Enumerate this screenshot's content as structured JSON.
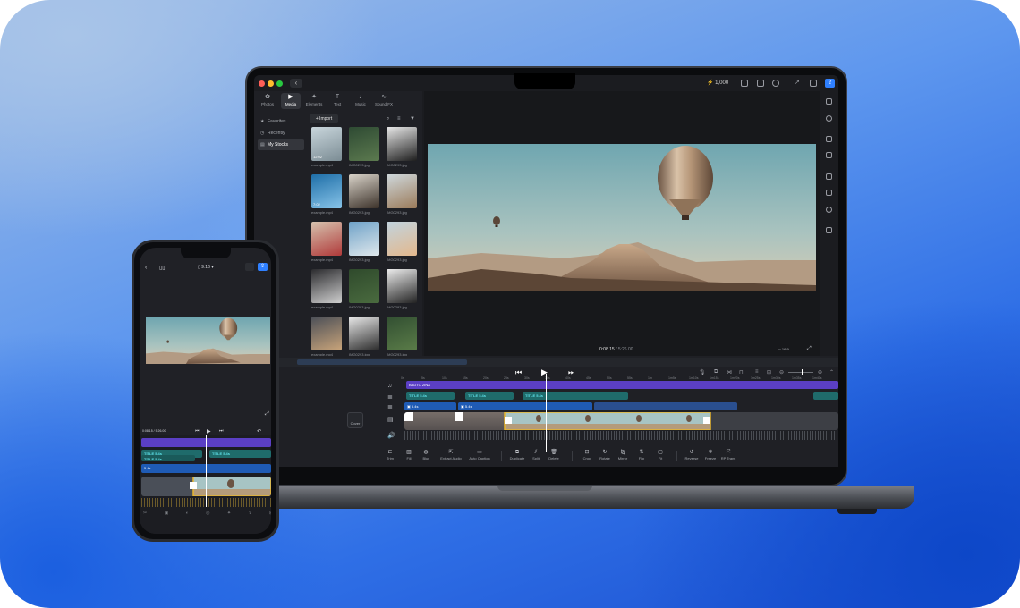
{
  "laptop": {
    "credits": "1,000",
    "categories": [
      {
        "label": "Photos",
        "icon": "photos-icon",
        "glyph": "✿"
      },
      {
        "label": "Media",
        "icon": "media-icon",
        "glyph": "▶"
      },
      {
        "label": "Elements",
        "icon": "elements-icon",
        "glyph": "✦"
      },
      {
        "label": "Text",
        "icon": "text-icon",
        "glyph": "T"
      },
      {
        "label": "Music",
        "icon": "music-icon",
        "glyph": "♪"
      },
      {
        "label": "Sound FX",
        "icon": "soundfx-icon",
        "glyph": "∿"
      }
    ],
    "side_nav": [
      {
        "label": "Favorites",
        "glyph": "★"
      },
      {
        "label": "Recently",
        "glyph": "◷"
      },
      {
        "label": "My Stocks",
        "glyph": "▤"
      }
    ],
    "import_label": "+ Import",
    "media": [
      {
        "name": "example.mp4",
        "duration": "12:02"
      },
      {
        "name": "IMG0293.jpg",
        "duration": ""
      },
      {
        "name": "IMG0293.jpg",
        "duration": ""
      },
      {
        "name": "example.mp4",
        "duration": "7:02"
      },
      {
        "name": "IMG0293.jpg",
        "duration": ""
      },
      {
        "name": "IMG0293.jpg",
        "duration": ""
      },
      {
        "name": "example.mp4",
        "duration": ""
      },
      {
        "name": "IMG0293.jpg",
        "duration": ""
      },
      {
        "name": "IMG0293.jpg",
        "duration": ""
      },
      {
        "name": "example.mp4",
        "duration": ""
      },
      {
        "name": "IMG0293.jpg",
        "duration": ""
      },
      {
        "name": "IMG0293.jpg",
        "duration": ""
      },
      {
        "name": "example.mp4",
        "duration": ""
      },
      {
        "name": "IMG0293.jpg",
        "duration": ""
      },
      {
        "name": "IMG0293.jpg",
        "duration": ""
      }
    ],
    "timecode_current": "0:08.15",
    "timecode_total": " / 5:26.00",
    "aspect_ratio": "16:9",
    "cover_label": "Cover",
    "tracks": {
      "music": "BADTO ZINA",
      "text1": "TITLE 5.4s",
      "text2": "TITLE 5.4s",
      "text3": "TITLE 5.4s",
      "text4": "TITLE 5.4s",
      "audio1": "5.4s",
      "audio2": "5.4s"
    },
    "ruler": [
      "0s",
      "5s",
      "10s",
      "15s",
      "20s",
      "25s",
      "30s",
      "35s",
      "40s",
      "45s",
      "50s",
      "55s",
      "1m",
      "1m5s",
      "1m10s",
      "1m15s",
      "1m20s",
      "1m25s",
      "1m30s",
      "1m35s",
      "1m40s"
    ],
    "tools": [
      "Trim",
      "Fill",
      "Blur",
      "Extract Audio",
      "Auto Caption",
      "Duplicate",
      "Split",
      "Delete",
      "Crop",
      "Rotate",
      "Mirror",
      "Flip",
      "Fit",
      "Reverse",
      "Freeze",
      "RP Trans"
    ]
  },
  "phone": {
    "aspect": "9:16",
    "timecode": "0:08.15 / 5:26.00",
    "text1": "TITLE 5.4s",
    "text2": "TITLE 5.4s",
    "text3": "TITLE 5.4s",
    "audio": "5.4s"
  }
}
